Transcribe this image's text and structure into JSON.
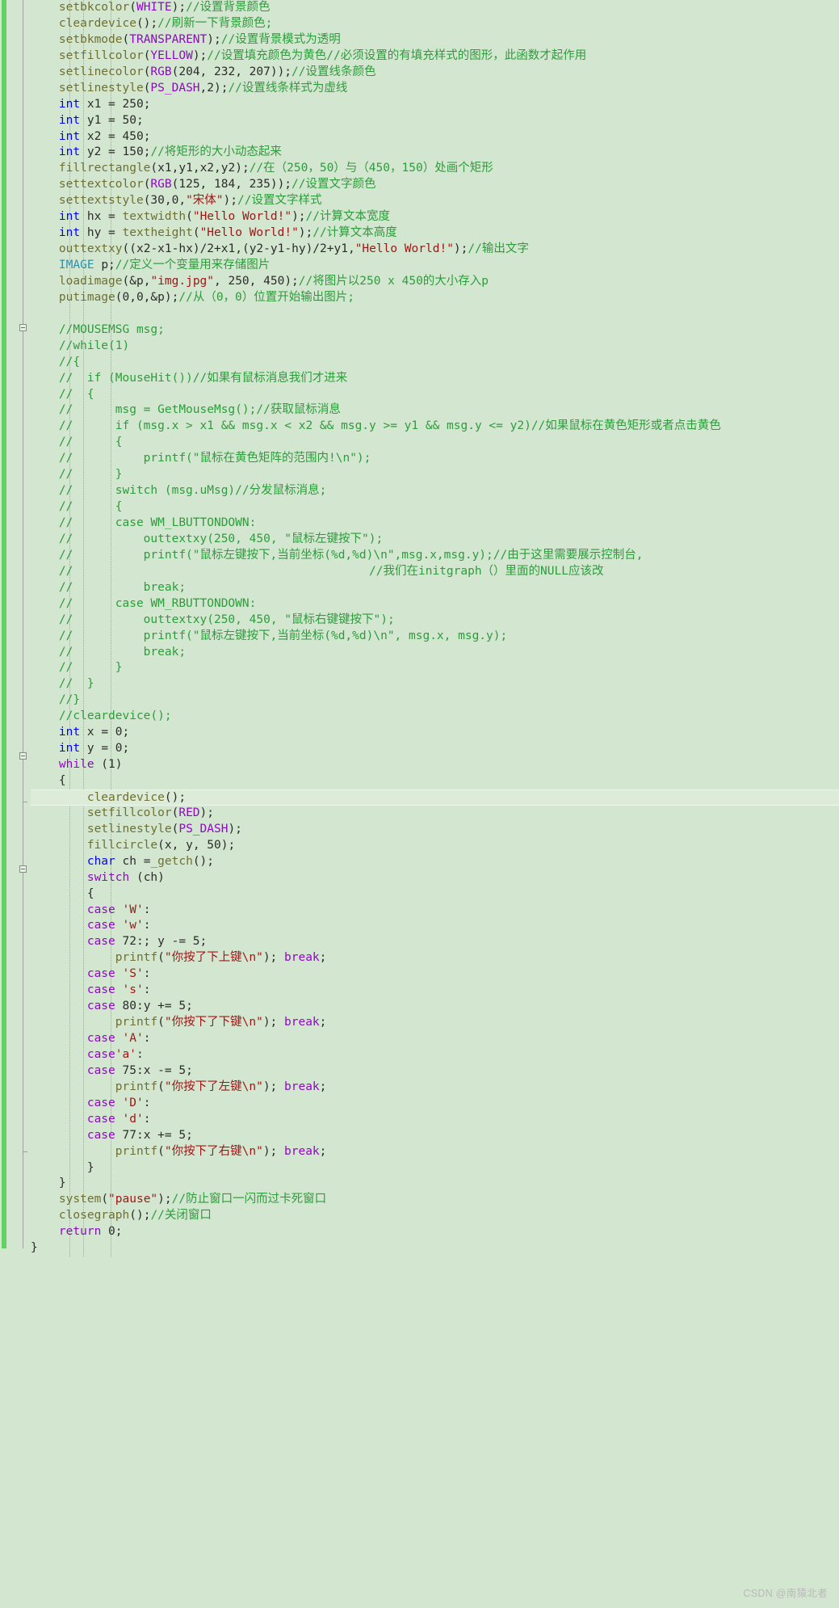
{
  "editor": {
    "app": "code-editor",
    "theme_background": "#d3e7d0",
    "comment_color": "#2e9b3c",
    "keyword_color": "#0000ff",
    "control_keyword_color": "#8f08c4",
    "string_color": "#a31515",
    "function_color": "#6f6f30",
    "type_color": "#2b91af",
    "changebar_color": "#62d162",
    "current_line_color": "#dcecd9"
  },
  "watermark": {
    "text": "CSDN @南猿北者"
  },
  "code_lines": [
    {
      "indent": 1,
      "text": "setbkcolor(WHITE);//设置背景颜色"
    },
    {
      "indent": 1,
      "text": "cleardevice();//刷新一下背景颜色;"
    },
    {
      "indent": 1,
      "text": "setbkmode(TRANSPARENT);//设置背景模式为透明"
    },
    {
      "indent": 1,
      "text": "setfillcolor(YELLOW);//设置填充颜色为黄色//必须设置的有填充样式的图形，此函数才起作用"
    },
    {
      "indent": 1,
      "text": "setlinecolor(RGB(204, 232, 207));//设置线条颜色"
    },
    {
      "indent": 1,
      "text": "setlinestyle(PS_DASH,2);//设置线条样式为虚线"
    },
    {
      "indent": 1,
      "text": "int x1 = 250;"
    },
    {
      "indent": 1,
      "text": "int y1 = 50;"
    },
    {
      "indent": 1,
      "text": "int x2 = 450;"
    },
    {
      "indent": 1,
      "text": "int y2 = 150;//将矩形的大小动态起来"
    },
    {
      "indent": 1,
      "text": "fillrectangle(x1,y1,x2,y2);//在（250，50）与（450，150）处画个矩形"
    },
    {
      "indent": 1,
      "text": "settextcolor(RGB(125, 184, 235));//设置文字颜色"
    },
    {
      "indent": 1,
      "text": "settextstyle(30,0,\"宋体\");//设置文字样式"
    },
    {
      "indent": 1,
      "text": "int hx = textwidth(\"Hello World!\");//计算文本宽度"
    },
    {
      "indent": 1,
      "text": "int hy = textheight(\"Hello World!\");//计算文本高度"
    },
    {
      "indent": 1,
      "text": "outtextxy((x2-x1-hx)/2+x1,(y2-y1-hy)/2+y1,\"Hello World!\");//输出文字"
    },
    {
      "indent": 1,
      "text": "IMAGE p;//定义一个变量用来存储图片"
    },
    {
      "indent": 1,
      "text": "loadimage(&p,\"img.jpg\", 250, 450);//将图片以250 x 450的大小存入p"
    },
    {
      "indent": 1,
      "text": "putimage(0,0,&p);//从（0，0）位置开始输出图片;"
    },
    {
      "indent": 0,
      "text": ""
    },
    {
      "indent": 1,
      "text": "//MOUSEMSG msg;"
    },
    {
      "indent": 1,
      "text": "//while(1)"
    },
    {
      "indent": 1,
      "text": "//{"
    },
    {
      "indent": 1,
      "text": "//  if (MouseHit())//如果有鼠标消息我们才进来"
    },
    {
      "indent": 1,
      "text": "//  {"
    },
    {
      "indent": 1,
      "text": "//      msg = GetMouseMsg();//获取鼠标消息"
    },
    {
      "indent": 1,
      "text": "//      if (msg.x > x1 && msg.x < x2 && msg.y >= y1 && msg.y <= y2)//如果鼠标在黄色矩形或者点击黄色"
    },
    {
      "indent": 1,
      "text": "//      {"
    },
    {
      "indent": 1,
      "text": "//          printf(\"鼠标在黄色矩阵的范围内!\\n\");"
    },
    {
      "indent": 1,
      "text": "//      }"
    },
    {
      "indent": 1,
      "text": "//      switch (msg.uMsg)//分发鼠标消息;"
    },
    {
      "indent": 1,
      "text": "//      {"
    },
    {
      "indent": 1,
      "text": "//      case WM_LBUTTONDOWN:"
    },
    {
      "indent": 1,
      "text": "//          outtextxy(250, 450, \"鼠标左键按下\");"
    },
    {
      "indent": 1,
      "text": "//          printf(\"鼠标左键按下,当前坐标(%d,%d)\\n\",msg.x,msg.y);//由于这里需要展示控制台,"
    },
    {
      "indent": 1,
      "text": "//                                          //我们在initgraph（）里面的NULL应该改"
    },
    {
      "indent": 1,
      "text": "//          break;"
    },
    {
      "indent": 1,
      "text": "//      case WM_RBUTTONDOWN:"
    },
    {
      "indent": 1,
      "text": "//          outtextxy(250, 450, \"鼠标右键键按下\");"
    },
    {
      "indent": 1,
      "text": "//          printf(\"鼠标左键按下,当前坐标(%d,%d)\\n\", msg.x, msg.y);"
    },
    {
      "indent": 1,
      "text": "//          break;"
    },
    {
      "indent": 1,
      "text": "//      }"
    },
    {
      "indent": 1,
      "text": "//  }"
    },
    {
      "indent": 1,
      "text": "//}"
    },
    {
      "indent": 1,
      "text": "//cleardevice();"
    },
    {
      "indent": 1,
      "text": "int x = 0;"
    },
    {
      "indent": 1,
      "text": "int y = 0;"
    },
    {
      "indent": 1,
      "text": "while (1)"
    },
    {
      "indent": 1,
      "text": "{"
    },
    {
      "indent": 2,
      "text": "cleardevice();",
      "current": true
    },
    {
      "indent": 2,
      "text": "setfillcolor(RED);"
    },
    {
      "indent": 2,
      "text": "setlinestyle(PS_DASH);"
    },
    {
      "indent": 2,
      "text": "fillcircle(x, y, 50);"
    },
    {
      "indent": 2,
      "text": "char ch =_getch();"
    },
    {
      "indent": 2,
      "text": "switch (ch)"
    },
    {
      "indent": 2,
      "text": "{"
    },
    {
      "indent": 2,
      "text": "case 'W':"
    },
    {
      "indent": 2,
      "text": "case 'w':"
    },
    {
      "indent": 2,
      "text": "case 72:; y -= 5;"
    },
    {
      "indent": 3,
      "text": "printf(\"你按了下上键\\n\"); break;"
    },
    {
      "indent": 2,
      "text": "case 'S':"
    },
    {
      "indent": 2,
      "text": "case 's':"
    },
    {
      "indent": 2,
      "text": "case 80:y += 5;"
    },
    {
      "indent": 3,
      "text": "printf(\"你按下了下键\\n\"); break;"
    },
    {
      "indent": 2,
      "text": "case 'A':"
    },
    {
      "indent": 2,
      "text": "case'a':"
    },
    {
      "indent": 2,
      "text": "case 75:x -= 5;"
    },
    {
      "indent": 3,
      "text": "printf(\"你按下了左键\\n\"); break;"
    },
    {
      "indent": 2,
      "text": "case 'D':"
    },
    {
      "indent": 2,
      "text": "case 'd':"
    },
    {
      "indent": 2,
      "text": "case 77:x += 5;"
    },
    {
      "indent": 3,
      "text": "printf(\"你按下了右键\\n\"); break;"
    },
    {
      "indent": 2,
      "text": "}"
    },
    {
      "indent": 1,
      "text": "}"
    },
    {
      "indent": 1,
      "text": "system(\"pause\");//防止窗口一闪而过卡死窗口"
    },
    {
      "indent": 1,
      "text": "closegraph();//关闭窗口"
    },
    {
      "indent": 1,
      "text": "return 0;"
    },
    {
      "indent": 0,
      "text": "}"
    }
  ]
}
